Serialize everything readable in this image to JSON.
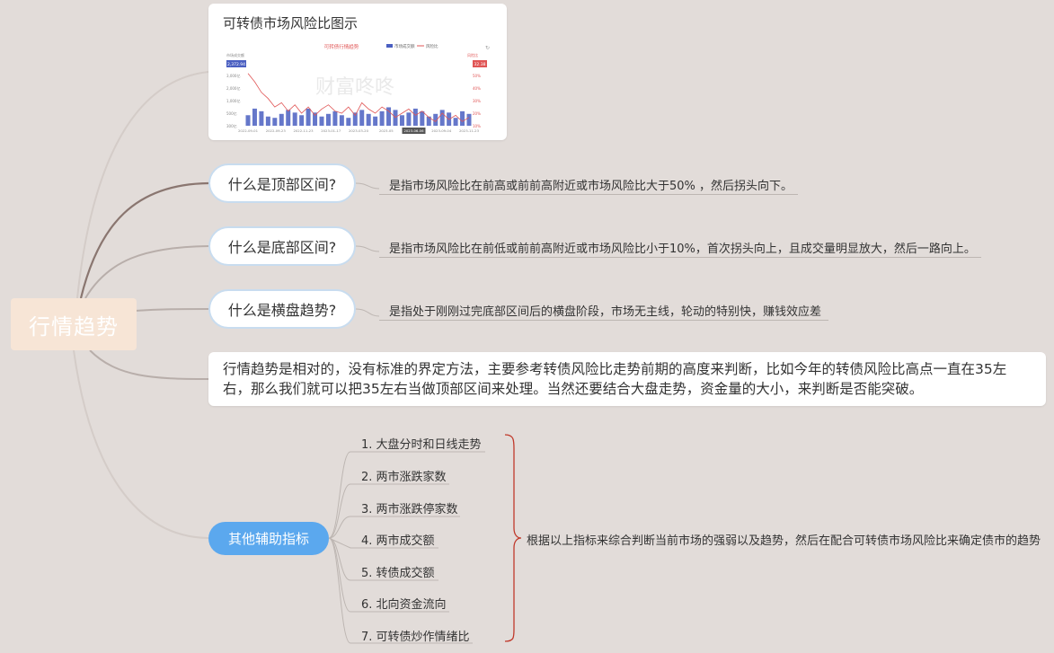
{
  "root": {
    "label": "行情趋势"
  },
  "chart_card": {
    "title": "可转债市场风险比图示",
    "watermark": "财富咚咚",
    "chart_data": {
      "type": "line",
      "title": "可转债行情趋势",
      "legend": [
        "市场成交额",
        "风险比"
      ],
      "legend_position": "top-right",
      "left_axis_badge": "2,372.94",
      "right_axis_badge": "32.38",
      "y_left_ticks": [
        "3,000亿",
        "2,000亿",
        "1,000亿",
        "500亿",
        "300亿"
      ],
      "y_right_ticks": [
        "50%",
        "40%",
        "30%",
        "20%",
        "10%"
      ],
      "x_ticks": [
        "2022-09-01",
        "2022-09-23",
        "2022-11-23",
        "2023-01-17",
        "2023-03-20",
        "2023-05",
        "2023-06-06",
        "2023-09-04",
        "2023-11-23"
      ],
      "series": [
        {
          "name": "风险比",
          "values": [
            60,
            52,
            42,
            36,
            28,
            32,
            24,
            30,
            22,
            28,
            20,
            26,
            30,
            24,
            22,
            28,
            20,
            32,
            26,
            22,
            28,
            24,
            18,
            22,
            26,
            20,
            24,
            18,
            14,
            22,
            16,
            20,
            14,
            18
          ]
        },
        {
          "name": "市场成交额",
          "values": [
            80,
            130,
            110,
            70,
            60,
            90,
            120,
            100,
            80,
            130,
            100,
            70,
            90,
            110,
            80,
            60,
            100,
            120,
            90,
            70,
            110,
            140,
            120,
            80,
            100,
            130,
            110,
            70,
            90,
            120,
            100,
            60,
            110,
            90
          ]
        }
      ]
    }
  },
  "questions": [
    {
      "label": "什么是顶部区间?",
      "desc": "是指市场风险比在前高或前前高附近或市场风险比大于50% ，然后拐头向下。"
    },
    {
      "label": "什么是底部区间?",
      "desc": "是指市场风险比在前低或前前高附近或市场风险比小于10%，首次拐头向上，且成交量明显放大，然后一路向上。"
    },
    {
      "label": "什么是横盘趋势?",
      "desc": "是指处于刚刚过完底部区间后的横盘阶段，市场无主线，轮动的特别快，赚钱效应差"
    }
  ],
  "note": "行情趋势是相对的，没有标准的界定方法，主要参考转债风险比走势前期的高度来判断，比如今年的转债风险比高点一直在35左右，那么我们就可以把35左右当做顶部区间来处理。当然还要结合大盘走势，资金量的大小，来判断是否能突破。",
  "other": {
    "label": "其他辅助指标",
    "items": [
      "1. 大盘分时和日线走势",
      "2. 两市涨跌家数",
      "3. 两市涨跌停家数",
      "4. 两市成交额",
      "5. 转债成交额",
      "6. 北向资金流向",
      "7. 可转债炒作情绪比"
    ],
    "conclusion": "根据以上指标来综合判断当前市场的强弱以及趋势，然后在配合可转债市场风险比来确定债市的趋势"
  },
  "colors": {
    "background": "#e2dcd9",
    "root_fill": "#f7e5d6",
    "blue_node": "#5ba8ee",
    "brace": "#c0392b",
    "risk_line": "#e05555",
    "volume_bars": "#4a5fc1"
  }
}
